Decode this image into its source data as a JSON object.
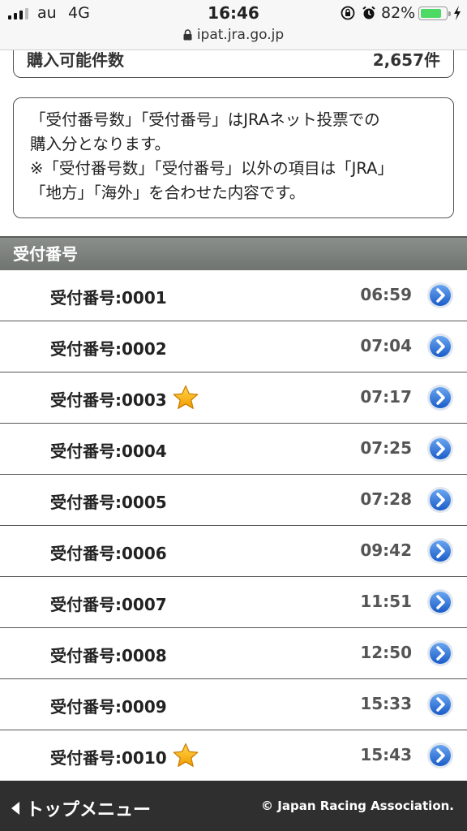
{
  "status_bar": {
    "carrier": "au",
    "network": "4G",
    "time": "16:46",
    "battery_percent": "82%",
    "battery_level": 0.82
  },
  "url_bar": {
    "url": "ipat.jra.go.jp"
  },
  "summary": {
    "label": "購入可能件数",
    "value": "2,657件"
  },
  "notice": {
    "lines": [
      "「受付番号数」「受付番号」はJRAネット投票での",
      "購入分となります。",
      "※「受付番号数」「受付番号」以外の項目は「JRA」",
      "「地方」「海外」を合わせた内容です。"
    ]
  },
  "section": {
    "title": "受付番号"
  },
  "receipts": [
    {
      "label": "受付番号:0001",
      "time": "06:59",
      "starred": false
    },
    {
      "label": "受付番号:0002",
      "time": "07:04",
      "starred": false
    },
    {
      "label": "受付番号:0003",
      "time": "07:17",
      "starred": true
    },
    {
      "label": "受付番号:0004",
      "time": "07:25",
      "starred": false
    },
    {
      "label": "受付番号:0005",
      "time": "07:28",
      "starred": false
    },
    {
      "label": "受付番号:0006",
      "time": "09:42",
      "starred": false
    },
    {
      "label": "受付番号:0007",
      "time": "11:51",
      "starred": false
    },
    {
      "label": "受付番号:0008",
      "time": "12:50",
      "starred": false
    },
    {
      "label": "受付番号:0009",
      "time": "15:33",
      "starred": false
    },
    {
      "label": "受付番号:0010",
      "time": "15:43",
      "starred": true
    }
  ],
  "footer": {
    "back_label": "トップメニュー",
    "copyright": "© Japan Racing Association."
  },
  "colors": {
    "section_header": "#7d827f",
    "footer_bg": "#2f2f2f",
    "go_button": "#2b72d9",
    "star": "#f5a400",
    "battery": "#4cd964"
  },
  "icons": {
    "row_action": "chevron-right-circle-icon",
    "row_mark": "star-icon",
    "back": "triangle-left-icon"
  }
}
